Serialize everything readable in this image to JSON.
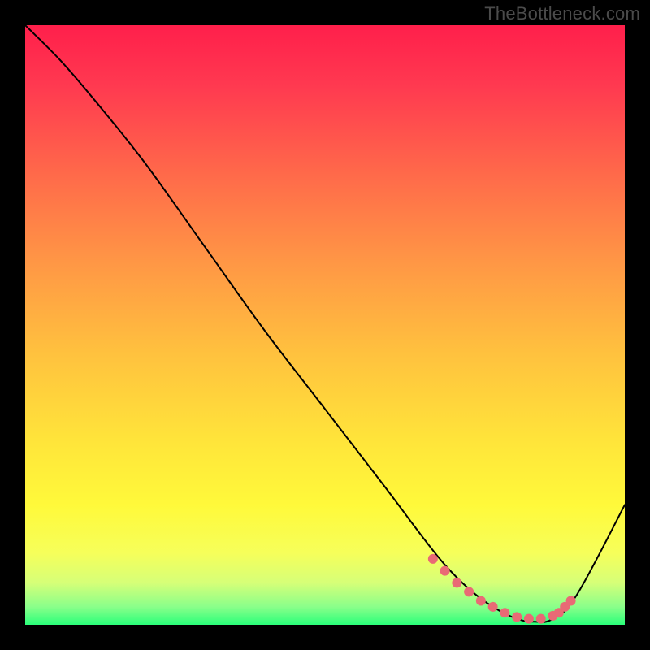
{
  "watermark": "TheBottleneck.com",
  "colors": {
    "dot": "#e96a75",
    "curve": "#000000"
  },
  "chart_data": {
    "type": "line",
    "title": "",
    "xlabel": "",
    "ylabel": "",
    "xlim": [
      0,
      100
    ],
    "ylim": [
      0,
      100
    ],
    "grid": false,
    "curve": {
      "x": [
        0,
        6,
        12,
        20,
        30,
        40,
        50,
        60,
        66,
        70,
        74,
        78,
        82,
        85,
        88,
        92,
        100
      ],
      "values": [
        100,
        94,
        87,
        77,
        63,
        49,
        36,
        23,
        15,
        10,
        6,
        3,
        1,
        0.5,
        1,
        5,
        20
      ]
    },
    "highlight_dots": {
      "x": [
        68,
        70,
        72,
        74,
        76,
        78,
        80,
        82,
        84,
        86,
        88,
        89,
        90,
        91
      ],
      "values": [
        11,
        9,
        7,
        5.5,
        4,
        3,
        2,
        1.3,
        1,
        1,
        1.5,
        2,
        3,
        4
      ]
    }
  }
}
